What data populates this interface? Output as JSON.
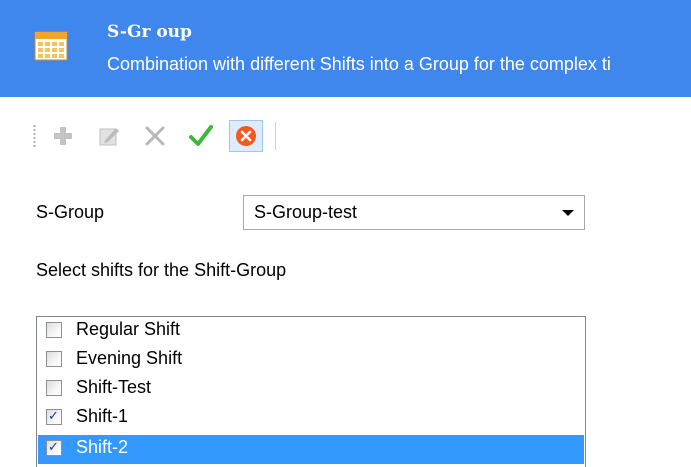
{
  "header": {
    "title": "S-Gr oup",
    "description": "Combination with different Shifts into a Group for the complex ti",
    "icon": "calendar-icon"
  },
  "toolbar": {
    "buttons": [
      {
        "name": "add",
        "icon": "plus-icon",
        "enabled": false
      },
      {
        "name": "edit",
        "icon": "edit-icon",
        "enabled": false
      },
      {
        "name": "delete",
        "icon": "x-icon",
        "enabled": false
      },
      {
        "name": "confirm",
        "icon": "check-icon",
        "enabled": true
      },
      {
        "name": "cancel",
        "icon": "cancel-circle-icon",
        "enabled": true,
        "active": true
      }
    ]
  },
  "form": {
    "sgroup_label": "S-Group",
    "sgroup_value": "S-Group-test",
    "select_label": "Select shifts for the Shift-Group"
  },
  "shifts": [
    {
      "label": "Regular Shift",
      "checked": false,
      "selected": false
    },
    {
      "label": "Evening Shift",
      "checked": false,
      "selected": false
    },
    {
      "label": "Shift-Test",
      "checked": false,
      "selected": false
    },
    {
      "label": "Shift-1",
      "checked": true,
      "selected": false
    },
    {
      "label": "Shift-2",
      "checked": true,
      "selected": true
    }
  ],
  "colors": {
    "header_bg": "#3f86ed",
    "selection": "#3399ff",
    "confirm_green": "#3cb83c",
    "cancel_orange": "#f05a1e"
  }
}
